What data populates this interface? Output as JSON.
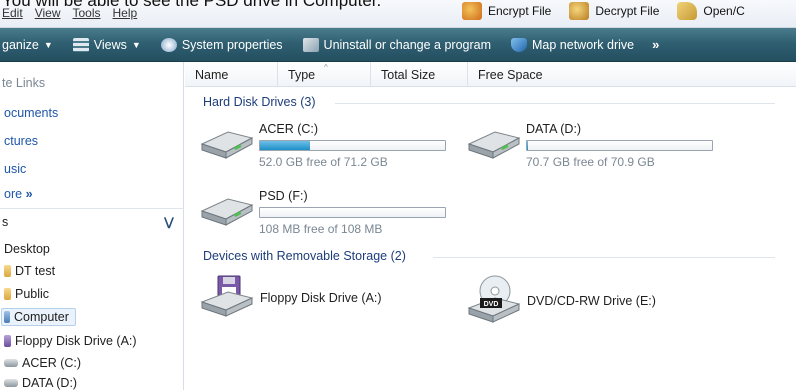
{
  "caption": "You will be able to see the PSD drive in Computer.",
  "menu": [
    "Edit",
    "View",
    "Tools",
    "Help"
  ],
  "top_tools": [
    {
      "label": "Encrypt File",
      "icon": "encrypt-icon"
    },
    {
      "label": "Decrypt File",
      "icon": "decrypt-icon"
    },
    {
      "label": "Open/C",
      "icon": "open-icon"
    }
  ],
  "commands": {
    "organize": "ganize",
    "views": "Views",
    "system_properties": "System properties",
    "uninstall": "Uninstall or change a program",
    "map_drive": "Map network drive",
    "more": "»"
  },
  "nav": {
    "favorites_title": "te Links",
    "links": [
      "ocuments",
      "ctures",
      "usic"
    ],
    "more": "ore",
    "more_chevron": "»",
    "folders_label": "s",
    "tree": [
      {
        "label": "Desktop",
        "icon": "none"
      },
      {
        "label": "DT test",
        "icon": "folder-icon"
      },
      {
        "label": "Public",
        "icon": "folder-icon"
      },
      {
        "label": "Computer",
        "icon": "computer-icon",
        "selected": true
      },
      {
        "label": "Floppy Disk Drive (A:)",
        "icon": "floppy-icon"
      },
      {
        "label": "ACER (C:)",
        "icon": "drive-icon"
      },
      {
        "label": "DATA (D:)",
        "icon": "drive-icon"
      }
    ]
  },
  "columns": [
    "Name",
    "Type",
    "Total Size",
    "Free Space"
  ],
  "groups": {
    "hard_disks": "Hard Disk Drives (3)",
    "removable": "Devices with Removable Storage (2)"
  },
  "drives": [
    {
      "name": "ACER (C:)",
      "free_text": "52.0 GB free of 71.2 GB",
      "used_fraction": 0.27
    },
    {
      "name": "DATA (D:)",
      "free_text": "70.7 GB free of 70.9 GB",
      "used_fraction": 0.003
    },
    {
      "name": "PSD (F:)",
      "free_text": "108 MB free of 108 MB",
      "used_fraction": 0.0
    }
  ],
  "removable": [
    {
      "name": "Floppy Disk Drive (A:)",
      "icon": "floppy-drive-icon"
    },
    {
      "name": "DVD/CD-RW Drive (E:)",
      "icon": "dvd-drive-icon",
      "badge": "DVD"
    }
  ],
  "colors": {
    "command_bar": "#2f5f71",
    "link": "#1f56a8",
    "group_title": "#1e3d7b",
    "progress": "#1f8fc7"
  }
}
